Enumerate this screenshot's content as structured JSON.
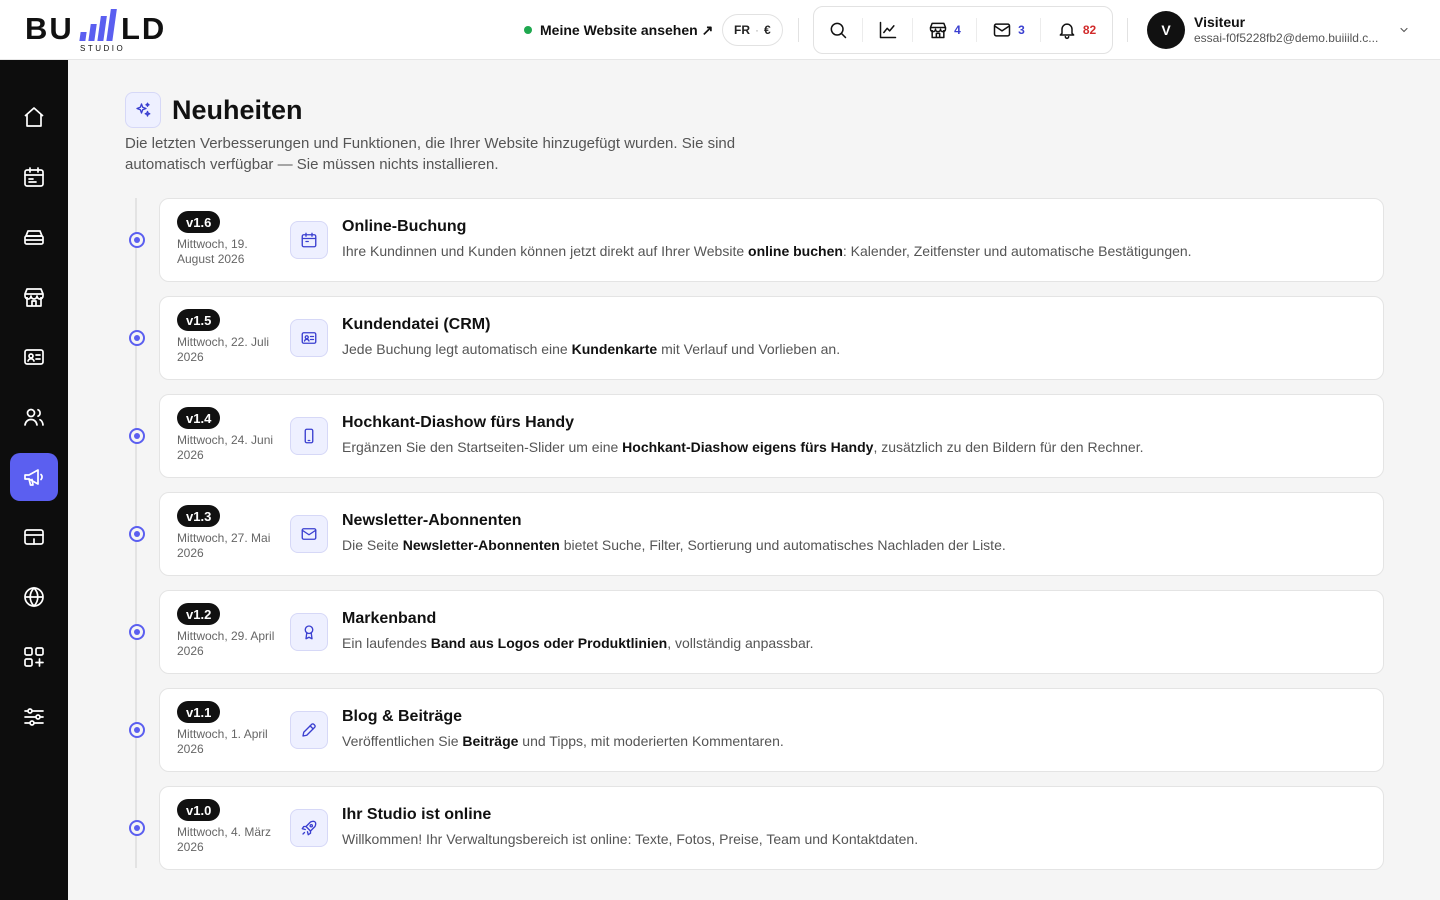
{
  "header": {
    "logo_alt": "BUILD STUDIO",
    "site_link": "Meine Website ansehen ↗",
    "lang": "FR",
    "currency": "€",
    "tools": {
      "shop_count": "4",
      "mail_count": "3",
      "notif_count": "82"
    },
    "user": {
      "initial": "V",
      "name": "Visiteur",
      "email": "essai-f0f5228fb2@demo.buiiild.c..."
    }
  },
  "sidebar": {
    "items": [
      {
        "name": "home",
        "icon": "home-icon"
      },
      {
        "name": "calendar",
        "icon": "calendar-icon"
      },
      {
        "name": "services",
        "icon": "tray-icon"
      },
      {
        "name": "store",
        "icon": "store-icon"
      },
      {
        "name": "contacts",
        "icon": "id-card-icon"
      },
      {
        "name": "team",
        "icon": "users-icon"
      },
      {
        "name": "news",
        "icon": "megaphone-icon",
        "active": true
      },
      {
        "name": "payments",
        "icon": "card-icon"
      },
      {
        "name": "website",
        "icon": "globe-icon"
      },
      {
        "name": "apps",
        "icon": "apps-icon"
      },
      {
        "name": "settings",
        "icon": "sliders-icon"
      }
    ]
  },
  "page": {
    "title": "Neuheiten",
    "description": "Die letzten Verbesserungen und Funktionen, die Ihrer Website hinzugefügt wurden. Sie sind automatisch verfügbar — Sie müssen nichts installieren."
  },
  "releases": [
    {
      "version": "v1.6",
      "date": "Mittwoch, 19. August 2026",
      "icon": "calendar-icon",
      "title": "Online-Buchung",
      "desc_before": "Ihre Kundinnen und Kunden können jetzt direkt auf Ihrer Website ",
      "desc_bold": "online buchen",
      "desc_after": ": Kalender, Zeitfenster und automatische Bestätigungen."
    },
    {
      "version": "v1.5",
      "date": "Mittwoch, 22. Juli 2026",
      "icon": "id-card-icon",
      "title": "Kundendatei (CRM)",
      "desc_before": "Jede Buchung legt automatisch eine ",
      "desc_bold": "Kundenkarte",
      "desc_after": " mit Verlauf und Vorlieben an."
    },
    {
      "version": "v1.4",
      "date": "Mittwoch, 24. Juni 2026",
      "icon": "phone-icon",
      "title": "Hochkant-Diashow fürs Handy",
      "desc_before": "Ergänzen Sie den Startseiten-Slider um eine ",
      "desc_bold": "Hochkant-Diashow eigens fürs Handy",
      "desc_after": ", zusätzlich zu den Bildern für den Rechner."
    },
    {
      "version": "v1.3",
      "date": "Mittwoch, 27. Mai 2026",
      "icon": "mail-icon",
      "title": "Newsletter-Abonnenten",
      "desc_before": "Die Seite ",
      "desc_bold": "Newsletter-Abonnenten",
      "desc_after": " bietet Suche, Filter, Sortierung und automatisches Nachladen der Liste."
    },
    {
      "version": "v1.2",
      "date": "Mittwoch, 29. April 2026",
      "icon": "award-icon",
      "title": "Markenband",
      "desc_before": "Ein laufendes ",
      "desc_bold": "Band aus Logos oder Produktlinien",
      "desc_after": ", vollständig anpassbar."
    },
    {
      "version": "v1.1",
      "date": "Mittwoch, 1. April 2026",
      "icon": "pencil-icon",
      "title": "Blog & Beiträge",
      "desc_before": "Veröffentlichen Sie ",
      "desc_bold": "Beiträge",
      "desc_after": " und Tipps, mit moderierten Kommentaren."
    },
    {
      "version": "v1.0",
      "date": "Mittwoch, 4. März 2026",
      "icon": "rocket-icon",
      "title": "Ihr Studio ist online",
      "desc_before": "Willkommen! Ihr Verwaltungsbereich ist online: Texte, Fotos, Preise, Team und Kontaktdaten.",
      "desc_bold": "",
      "desc_after": ""
    }
  ]
}
